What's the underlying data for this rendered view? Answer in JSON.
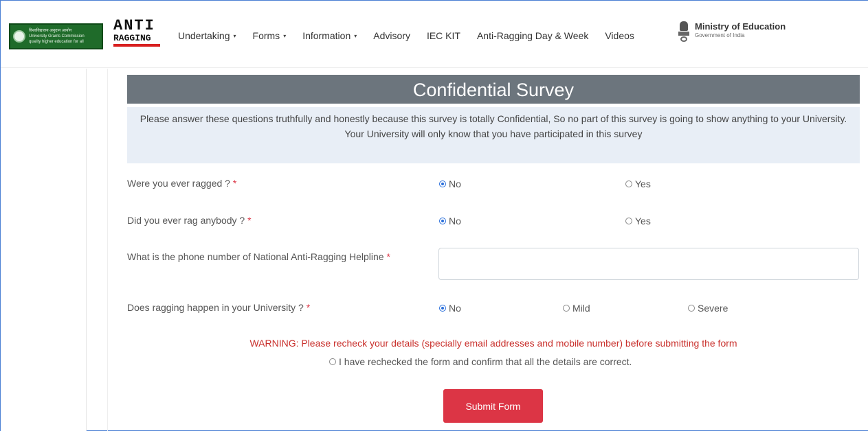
{
  "header": {
    "ugc_logo_lines": [
      "विश्वविद्यालय अनुदान आयोग",
      "University Grants Commission",
      "quality higher education for all"
    ],
    "anti_logo_top": "ANTI",
    "anti_logo_bottom": "RAGGING",
    "nav": [
      {
        "label": "Undertaking",
        "dropdown": true
      },
      {
        "label": "Forms",
        "dropdown": true
      },
      {
        "label": "Information",
        "dropdown": true
      },
      {
        "label": "Advisory",
        "dropdown": false
      },
      {
        "label": "IEC KIT",
        "dropdown": false
      },
      {
        "label": "Anti-Ragging Day & Week",
        "dropdown": false
      },
      {
        "label": "Videos",
        "dropdown": false
      }
    ],
    "caret": "▾",
    "ministry_title": "Ministry of Education",
    "ministry_sub": "Government of India"
  },
  "survey": {
    "title": "Confidential Survey",
    "notice_line1": "Please answer these questions truthfully and honestly because this survey is totally Confidential, So no part of this survey is going to show anything to your University.",
    "notice_line2": "Your University will only know that you have participated in this survey",
    "required_mark": "*",
    "questions": {
      "q1": {
        "label": "Were you ever ragged ?",
        "options": [
          "No",
          "Yes"
        ],
        "selected": "No"
      },
      "q2": {
        "label": "Did you ever rag anybody ?",
        "options": [
          "No",
          "Yes"
        ],
        "selected": "No"
      },
      "q3": {
        "label": "What is the phone number of National Anti-Ragging Helpline",
        "value": "",
        "placeholder": ""
      },
      "q4": {
        "label": "Does ragging happen in your University ?",
        "options": [
          "No",
          "Mild",
          "Severe"
        ],
        "selected": "No"
      }
    },
    "warning": "WARNING: Please recheck your details (specially email addresses and mobile number) before submitting the form",
    "confirm_label": "I have rechecked the form and confirm that all the details are correct.",
    "submit_label": "Submit Form"
  },
  "colors": {
    "title_bar": "#6c757d",
    "notice_bg": "#e8eef6",
    "required": "#dc3545",
    "warning": "#c9302c",
    "submit": "#dc3545",
    "radio_checked": "#2a6fdb"
  }
}
